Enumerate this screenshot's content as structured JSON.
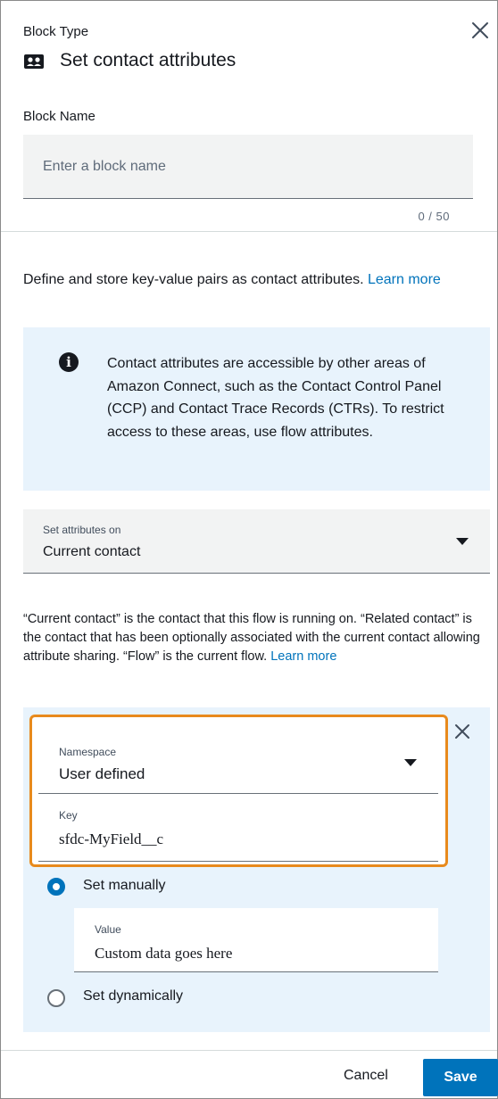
{
  "header": {
    "block_type_label": "Block Type",
    "title": "Set contact attributes",
    "icon": "contact-card-icon",
    "close_icon": "close-icon"
  },
  "block_name": {
    "label": "Block Name",
    "placeholder": "Enter a block name",
    "value": "",
    "char_count": "0 / 50"
  },
  "description": {
    "text": "Define and store key-value pairs as contact attributes. ",
    "link": "Learn more"
  },
  "info_box": {
    "icon": "info-icon",
    "text": "Contact attributes are accessible by other areas of Amazon Connect, such as the Contact Control Panel (CCP) and Contact Trace Records (CTRs). To restrict access to these areas, use flow attributes."
  },
  "set_attributes_on": {
    "label": "Set attributes on",
    "value": "Current contact"
  },
  "contact_description": {
    "text": "“Current contact” is the contact that this flow is running on. “Related contact” is the contact that has been optionally associated with the current contact allowing attribute sharing. “Flow” is the current flow. ",
    "link": "Learn more"
  },
  "attribute": {
    "namespace_label": "Namespace",
    "namespace_value": "User defined",
    "key_label": "Key",
    "key_value": "sfdc-MyField__c",
    "set_manually_label": "Set manually",
    "set_manually_checked": true,
    "value_label": "Value",
    "value_value": "Custom data goes here",
    "set_dynamically_label": "Set dynamically",
    "set_dynamically_checked": false,
    "highlight_color": "#e88a1d"
  },
  "footer": {
    "cancel_label": "Cancel",
    "save_label": "Save"
  },
  "colors": {
    "accent": "#0073bb",
    "info_background": "#e8f3fc",
    "input_background": "#f2f3f3"
  }
}
